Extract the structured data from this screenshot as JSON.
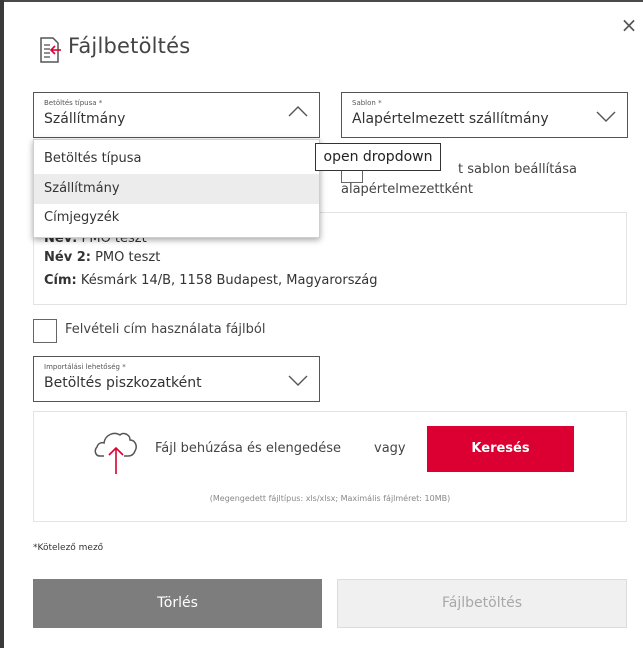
{
  "dialog": {
    "title": "Fájlbetöltés",
    "close_icon": "×"
  },
  "load_type": {
    "label": "Betöltés típusa *",
    "value": "Szállítmány",
    "options": [
      "Betöltés típusa",
      "Szállítmány",
      "Címjegyzék"
    ],
    "selected_index": 1
  },
  "template": {
    "label": "Sablon *",
    "value": "Alapértelmezett szállítmány"
  },
  "tooltip": "open dropdown",
  "default_template": {
    "text_visible": "t sablon beállítása",
    "text_line2": "alapértelmezettként"
  },
  "address": {
    "name_label": "Név:",
    "name_value": "PMO teszt",
    "name2_label": "Név 2:",
    "name2_value": "PMO teszt",
    "address_label": "Cím:",
    "address_value": "Késmárk 14/B, 1158 Budapest, Magyarország"
  },
  "pickup_checkbox": {
    "label": "Felvételi cím használata fájlból"
  },
  "import_option": {
    "label": "Importálási lehetőség *",
    "value": "Betöltés piszkozatként"
  },
  "upload": {
    "drop_text": "Fájl behúzása és elengedése",
    "or_text": "vagy",
    "search_label": "Keresés",
    "hint": "(Megengedett fájltípus: xls/xlsx; Maximális fájlméret: 10MB)"
  },
  "required_note": "*Kötelező mező",
  "buttons": {
    "clear": "Törlés",
    "submit": "Fájlbetöltés"
  },
  "colors": {
    "accent_red": "#dc0032",
    "highlight_yellow": "#ffeb00",
    "grey_button": "#7d7d7d"
  }
}
